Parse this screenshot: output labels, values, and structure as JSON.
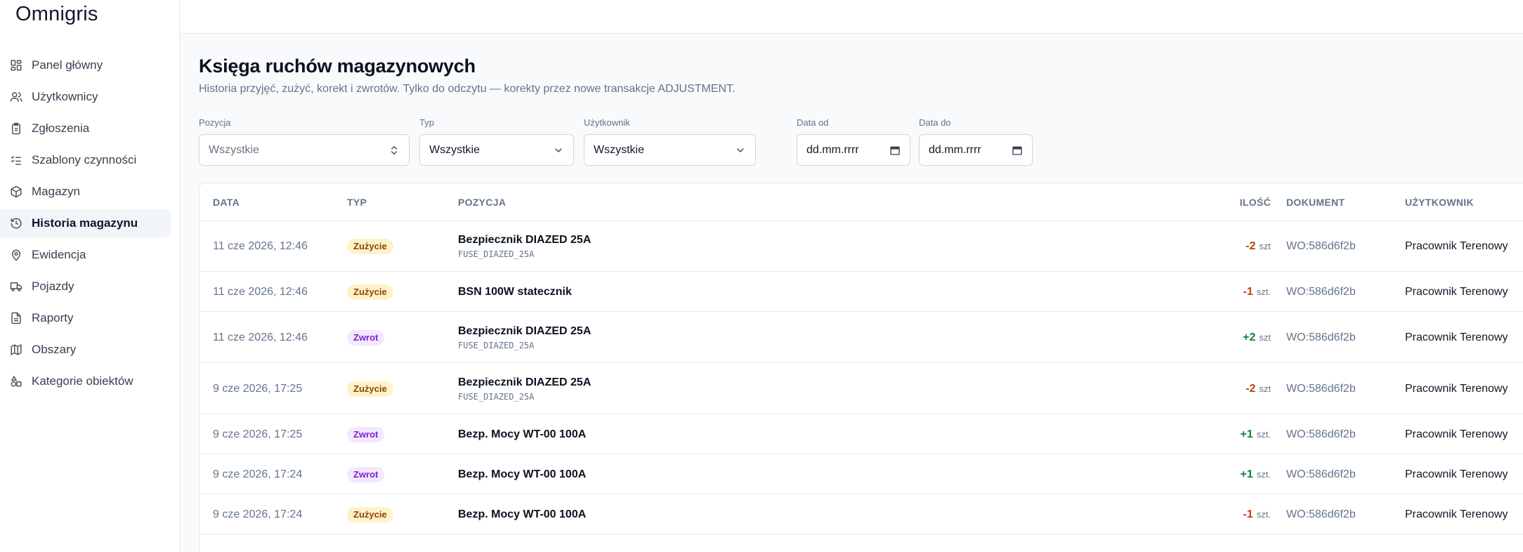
{
  "app": {
    "logo_text": "mnigris",
    "logo_mark": "O"
  },
  "sidebar": {
    "items": [
      {
        "label": "Panel główny",
        "icon": "dashboard-grid-icon",
        "active": false
      },
      {
        "label": "Użytkownicy",
        "icon": "users-icon",
        "active": false
      },
      {
        "label": "Zgłoszenia",
        "icon": "clipboard-icon",
        "active": false
      },
      {
        "label": "Szablony czynności",
        "icon": "list-checks-icon",
        "active": false
      },
      {
        "label": "Magazyn",
        "icon": "package-icon",
        "active": false
      },
      {
        "label": "Historia magazynu",
        "icon": "history-icon",
        "active": true
      },
      {
        "label": "Ewidencja",
        "icon": "map-pin-icon",
        "active": false
      },
      {
        "label": "Pojazdy",
        "icon": "truck-icon",
        "active": false
      },
      {
        "label": "Raporty",
        "icon": "file-text-icon",
        "active": false
      },
      {
        "label": "Obszary",
        "icon": "map-icon",
        "active": false
      },
      {
        "label": "Kategorie obiektów",
        "icon": "shapes-icon",
        "active": false
      }
    ]
  },
  "page": {
    "title": "Księga ruchów magazynowych",
    "subtitle": "Historia przyjęć, zużyć, korekt i zwrotów. Tylko do odczytu — korekty przez nowe transakcje ADJUSTMENT."
  },
  "filters": {
    "position": {
      "label": "Pozycja",
      "value": "Wszystkie"
    },
    "type": {
      "label": "Typ",
      "value": "Wszystkie"
    },
    "user": {
      "label": "Użytkownik",
      "value": "Wszystkie"
    },
    "date_from": {
      "label": "Data od",
      "value": "dd.mm.rrrr"
    },
    "date_to": {
      "label": "Data do",
      "value": "dd.mm.rrrr"
    }
  },
  "table": {
    "headers": {
      "date": "DATA",
      "type": "TYP",
      "position": "POZYCJA",
      "quantity": "ILOŚĆ",
      "document": "DOKUMENT",
      "user": "UŻYTKOWNIK"
    },
    "rows": [
      {
        "date": "11 cze 2026, 12:46",
        "type": "Zużycie",
        "kind": "zuzycie",
        "name": "Bezpiecznik DIAZED 25A",
        "code": "FUSE_DIAZED_25A",
        "qty": "-2",
        "unit": "szt",
        "sign": "neg",
        "doc": "WO:586d6f2b",
        "user": "Pracownik Terenowy"
      },
      {
        "date": "11 cze 2026, 12:46",
        "type": "Zużycie",
        "kind": "zuzycie",
        "name": "BSN 100W statecznik",
        "code": "",
        "qty": "-1",
        "unit": "szt.",
        "sign": "neg",
        "doc": "WO:586d6f2b",
        "user": "Pracownik Terenowy"
      },
      {
        "date": "11 cze 2026, 12:46",
        "type": "Zwrot",
        "kind": "zwrot",
        "name": "Bezpiecznik DIAZED 25A",
        "code": "FUSE_DIAZED_25A",
        "qty": "+2",
        "unit": "szt",
        "sign": "pos",
        "doc": "WO:586d6f2b",
        "user": "Pracownik Terenowy"
      },
      {
        "date": "9 cze 2026, 17:25",
        "type": "Zużycie",
        "kind": "zuzycie",
        "name": "Bezpiecznik DIAZED 25A",
        "code": "FUSE_DIAZED_25A",
        "qty": "-2",
        "unit": "szt",
        "sign": "neg",
        "doc": "WO:586d6f2b",
        "user": "Pracownik Terenowy"
      },
      {
        "date": "9 cze 2026, 17:25",
        "type": "Zwrot",
        "kind": "zwrot",
        "name": "Bezp. Mocy WT-00 100A",
        "code": "",
        "qty": "+1",
        "unit": "szt.",
        "sign": "pos",
        "doc": "WO:586d6f2b",
        "user": "Pracownik Terenowy"
      },
      {
        "date": "9 cze 2026, 17:24",
        "type": "Zwrot",
        "kind": "zwrot",
        "name": "Bezp. Mocy WT-00 100A",
        "code": "",
        "qty": "+1",
        "unit": "szt.",
        "sign": "pos",
        "doc": "WO:586d6f2b",
        "user": "Pracownik Terenowy"
      },
      {
        "date": "9 cze 2026, 17:24",
        "type": "Zużycie",
        "kind": "zuzycie",
        "name": "Bezp. Mocy WT-00 100A",
        "code": "",
        "qty": "-1",
        "unit": "szt.",
        "sign": "neg",
        "doc": "WO:586d6f2b",
        "user": "Pracownik Terenowy"
      }
    ]
  },
  "colors": {
    "zuzycie_bg": "#fef3c7",
    "zwrot_bg": "#f3e8ff",
    "negative": "#c2410c",
    "positive": "#15803d"
  }
}
